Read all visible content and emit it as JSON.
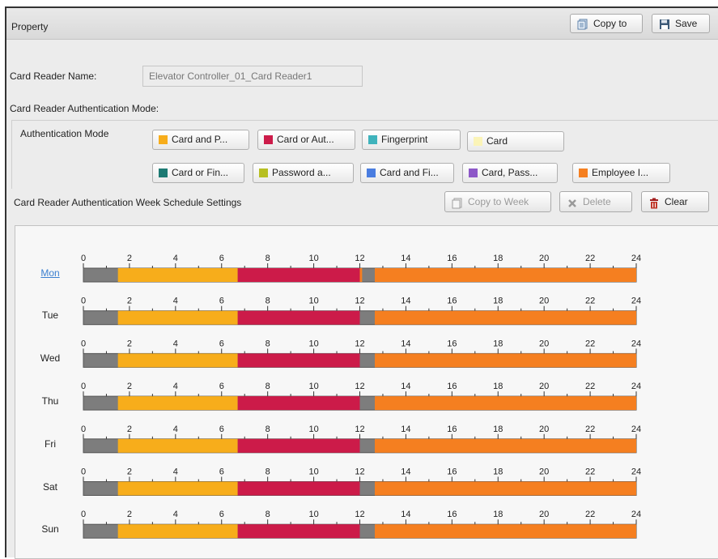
{
  "header": {
    "title": "Property",
    "copy_to": "Copy to",
    "save": "Save"
  },
  "card_reader": {
    "name_label": "Card Reader Name:",
    "name_value": "Elevator Controller_01_Card Reader1",
    "auth_mode_label": "Card Reader Authentication Mode:"
  },
  "auth_modes": {
    "label": "Authentication Mode",
    "items": [
      {
        "label": "Card and P...",
        "color": "#f7ad1b"
      },
      {
        "label": "Card or Aut...",
        "color": "#cc1b49"
      },
      {
        "label": "Fingerprint",
        "color": "#3fb3bc"
      },
      {
        "label": "Card",
        "color": "#fbf4b8"
      },
      {
        "label": "Card or Fin...",
        "color": "#1d7a73"
      },
      {
        "label": "Password a...",
        "color": "#b7bf22"
      },
      {
        "label": "Card and Fi...",
        "color": "#4a7de0"
      },
      {
        "label": "Card, Pass...",
        "color": "#8d58c8"
      },
      {
        "label": "Employee I...",
        "color": "#f57f20"
      }
    ]
  },
  "week_schedule": {
    "title": "Card Reader Authentication Week Schedule Settings",
    "copy_to_week": "Copy to Week",
    "delete": "Delete",
    "clear": "Clear"
  },
  "timeline": {
    "hours_max": 24,
    "tick_labels": [
      "0",
      "2",
      "4",
      "6",
      "8",
      "10",
      "12",
      "14",
      "16",
      "18",
      "20",
      "22",
      "24"
    ],
    "empty_color": "#7d7d7d",
    "days": [
      {
        "name": "Mon",
        "selected": true,
        "segments": [
          {
            "start": 1.5,
            "end": 6.7,
            "mode": "Card and P..."
          },
          {
            "start": 6.7,
            "end": 12.0,
            "mode": "Card or Aut..."
          },
          {
            "start": 12.0,
            "end": 12.1,
            "mode": "Employee I..."
          },
          {
            "start": 12.65,
            "end": 24,
            "mode": "Employee I..."
          }
        ]
      },
      {
        "name": "Tue",
        "selected": false,
        "segments": [
          {
            "start": 1.5,
            "end": 6.7,
            "mode": "Card and P..."
          },
          {
            "start": 6.7,
            "end": 12.0,
            "mode": "Card or Aut..."
          },
          {
            "start": 12.65,
            "end": 24,
            "mode": "Employee I..."
          }
        ]
      },
      {
        "name": "Wed",
        "selected": false,
        "segments": [
          {
            "start": 1.5,
            "end": 6.7,
            "mode": "Card and P..."
          },
          {
            "start": 6.7,
            "end": 12.0,
            "mode": "Card or Aut..."
          },
          {
            "start": 12.65,
            "end": 24,
            "mode": "Employee I..."
          }
        ]
      },
      {
        "name": "Thu",
        "selected": false,
        "segments": [
          {
            "start": 1.5,
            "end": 6.7,
            "mode": "Card and P..."
          },
          {
            "start": 6.7,
            "end": 12.0,
            "mode": "Card or Aut..."
          },
          {
            "start": 12.65,
            "end": 24,
            "mode": "Employee I..."
          }
        ]
      },
      {
        "name": "Fri",
        "selected": false,
        "segments": [
          {
            "start": 1.5,
            "end": 6.7,
            "mode": "Card and P..."
          },
          {
            "start": 6.7,
            "end": 12.0,
            "mode": "Card or Aut..."
          },
          {
            "start": 12.65,
            "end": 24,
            "mode": "Employee I..."
          }
        ]
      },
      {
        "name": "Sat",
        "selected": false,
        "segments": [
          {
            "start": 1.5,
            "end": 6.7,
            "mode": "Card and P..."
          },
          {
            "start": 6.7,
            "end": 12.0,
            "mode": "Card or Aut..."
          },
          {
            "start": 12.65,
            "end": 24,
            "mode": "Employee I..."
          }
        ]
      },
      {
        "name": "Sun",
        "selected": false,
        "segments": [
          {
            "start": 1.5,
            "end": 6.7,
            "mode": "Card and P..."
          },
          {
            "start": 6.7,
            "end": 12.0,
            "mode": "Card or Aut..."
          },
          {
            "start": 12.65,
            "end": 24,
            "mode": "Employee I..."
          }
        ]
      }
    ]
  },
  "icons": {
    "copy_to": "copy-icon",
    "save": "floppy-disk-icon",
    "copy_to_week": "copy-icon",
    "delete": "x-icon",
    "clear": "trash-icon"
  }
}
